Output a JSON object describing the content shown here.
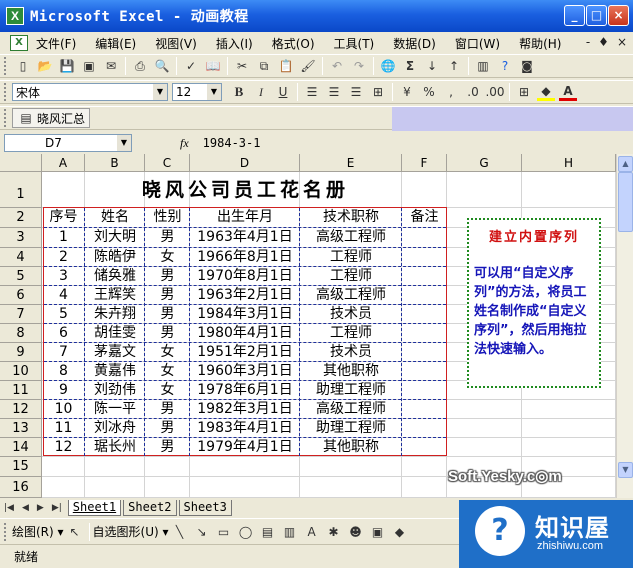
{
  "window": {
    "title": "Microsoft Excel - 动画教程",
    "buttons": [
      "_",
      "□",
      "×"
    ]
  },
  "menubar": {
    "items": [
      "文件(F)",
      "编辑(E)",
      "视图(V)",
      "插入(I)",
      "格式(O)",
      "工具(T)",
      "数据(D)",
      "窗口(W)",
      "帮助(H)"
    ],
    "right_controls": [
      "-",
      "♦",
      "×"
    ]
  },
  "format_toolbar": {
    "font": "宋体",
    "size": "12"
  },
  "custom_toolbar": {
    "label": "晓风汇总"
  },
  "formula_bar": {
    "name_box": "D7",
    "fx": "fx",
    "value": "1984-3-1"
  },
  "columns": [
    "A",
    "B",
    "C",
    "D",
    "E",
    "F",
    "G",
    "H"
  ],
  "rows": [
    "1",
    "2",
    "3",
    "4",
    "5",
    "6",
    "7",
    "8",
    "9",
    "10",
    "11",
    "12",
    "13",
    "14",
    "15",
    "16"
  ],
  "sheet": {
    "title": "晓风公司员工花名册",
    "headers": [
      "序号",
      "姓名",
      "性别",
      "出生年月",
      "技术职称",
      "备注"
    ],
    "records": [
      [
        "1",
        "刘大明",
        "男",
        "1963年4月1日",
        "高级工程师",
        ""
      ],
      [
        "2",
        "陈皓伊",
        "女",
        "1966年8月1日",
        "工程师",
        ""
      ],
      [
        "3",
        "储奂雅",
        "男",
        "1970年8月1日",
        "工程师",
        ""
      ],
      [
        "4",
        "王辉笑",
        "男",
        "1963年2月1日",
        "高级工程师",
        ""
      ],
      [
        "5",
        "朱卉翔",
        "男",
        "1984年3月1日",
        "技术员",
        ""
      ],
      [
        "6",
        "胡佳雯",
        "男",
        "1980年4月1日",
        "工程师",
        ""
      ],
      [
        "7",
        "茅嘉文",
        "女",
        "1951年2月1日",
        "技术员",
        ""
      ],
      [
        "8",
        "黄嘉伟",
        "女",
        "1960年3月1日",
        "其他职称",
        ""
      ],
      [
        "9",
        "刘劲伟",
        "女",
        "1978年6月1日",
        "助理工程师",
        ""
      ],
      [
        "10",
        "陈一平",
        "男",
        "1982年3月1日",
        "高级工程师",
        ""
      ],
      [
        "11",
        "刘冰舟",
        "男",
        "1983年4月1日",
        "助理工程师",
        ""
      ],
      [
        "12",
        "琚长州",
        "男",
        "1979年4月1日",
        "其他职称",
        ""
      ]
    ]
  },
  "note": {
    "title": "建立内置序列",
    "body": "可以用“自定义序列”的方法，将员工姓名制作成“自定义序列”，然后用拖拉法快速输入。"
  },
  "sheet_tabs": [
    "Sheet1",
    "Sheet2",
    "Sheet3"
  ],
  "draw_toolbar": {
    "draw_label": "绘图(R) ▾",
    "autoshape_label": "自选图形(U) ▾"
  },
  "status": "就绪",
  "watermark": "Soft.Yesky.c◎m",
  "logo": {
    "name": "知识屋",
    "url": "zhishiwu.com"
  },
  "colors": {
    "title_blue": "#0a48c8",
    "table_border": "#d02020",
    "note_border": "#1f8a1f",
    "note_text": "#1515b8",
    "note_title": "#d01010"
  }
}
